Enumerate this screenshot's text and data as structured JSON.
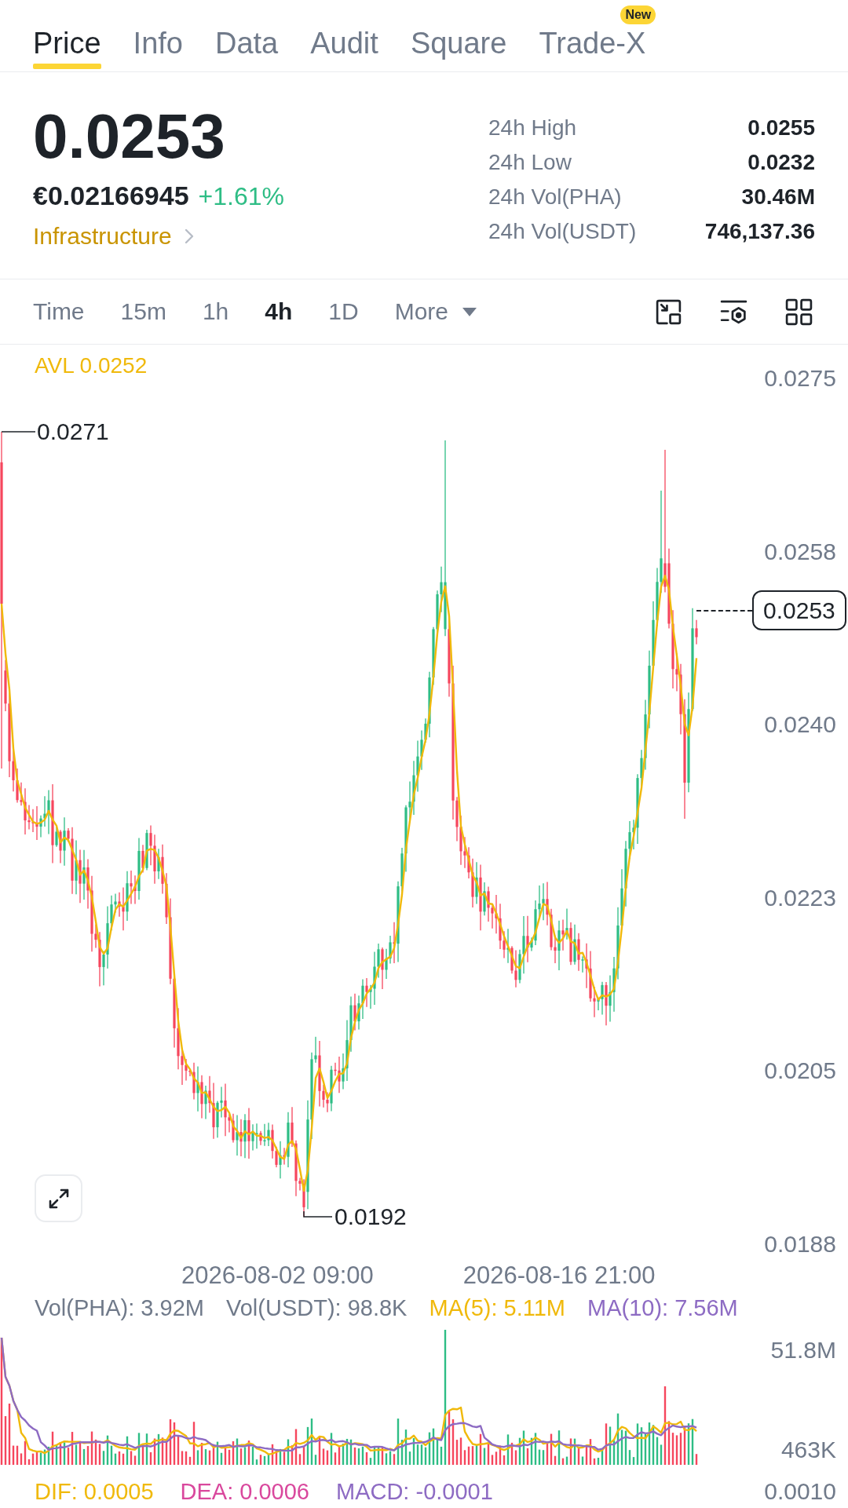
{
  "tabs": [
    {
      "label": "Price",
      "selected": true
    },
    {
      "label": "Info",
      "selected": false
    },
    {
      "label": "Data",
      "selected": false
    },
    {
      "label": "Audit",
      "selected": false
    },
    {
      "label": "Square",
      "selected": false
    },
    {
      "label": "Trade-X",
      "selected": false,
      "badge": "New"
    }
  ],
  "quote": {
    "price": "0.0253",
    "fiat_price": "€0.02166945",
    "change": "+1.61%",
    "rising": true,
    "category": "Infrastructure"
  },
  "stats": [
    {
      "label": "24h High",
      "value": "0.0255"
    },
    {
      "label": "24h Low",
      "value": "0.0232"
    },
    {
      "label": "24h Vol(PHA)",
      "value": "30.46M"
    },
    {
      "label": "24h Vol(USDT)",
      "value": "746,137.36"
    }
  ],
  "intervals": [
    {
      "label": "Time",
      "selected": false,
      "kind": "option"
    },
    {
      "label": "15m",
      "selected": false,
      "kind": "option"
    },
    {
      "label": "1h",
      "selected": false,
      "kind": "option"
    },
    {
      "label": "4h",
      "selected": true,
      "kind": "option"
    },
    {
      "label": "1D",
      "selected": false,
      "kind": "option"
    },
    {
      "label": "More",
      "selected": false,
      "kind": "menu"
    }
  ],
  "price_chart": {
    "avl": "AVL 0.0252",
    "y_axis": [
      "0.0275",
      "0.0258",
      "0.0240",
      "0.0223",
      "0.0205",
      "0.0188"
    ],
    "current_price": "0.0253",
    "high_marker": "0.0271",
    "low_marker": "0.0192",
    "x_axis": [
      "2026-08-02 09:00",
      "2026-08-16 21:00"
    ]
  },
  "volume": {
    "legend": [
      {
        "text": "Vol(PHA): 3.92M",
        "color": "#707a8a"
      },
      {
        "text": "Vol(USDT): 98.8K",
        "color": "#707a8a"
      },
      {
        "text": "MA(5): 5.11M",
        "color": "#f0b90b"
      },
      {
        "text": "MA(10): 7.56M",
        "color": "#8d6bc3"
      }
    ],
    "y_axis": [
      "51.8M",
      "463K"
    ]
  },
  "macd": {
    "legend": [
      {
        "text": "DIF: 0.0005",
        "color": "#f0b90b"
      },
      {
        "text": "DEA: 0.0006",
        "color": "#d9489d"
      },
      {
        "text": "MACD: -0.0001",
        "color": "#8d6bc3"
      }
    ],
    "y_axis": [
      "0.0010"
    ]
  }
}
